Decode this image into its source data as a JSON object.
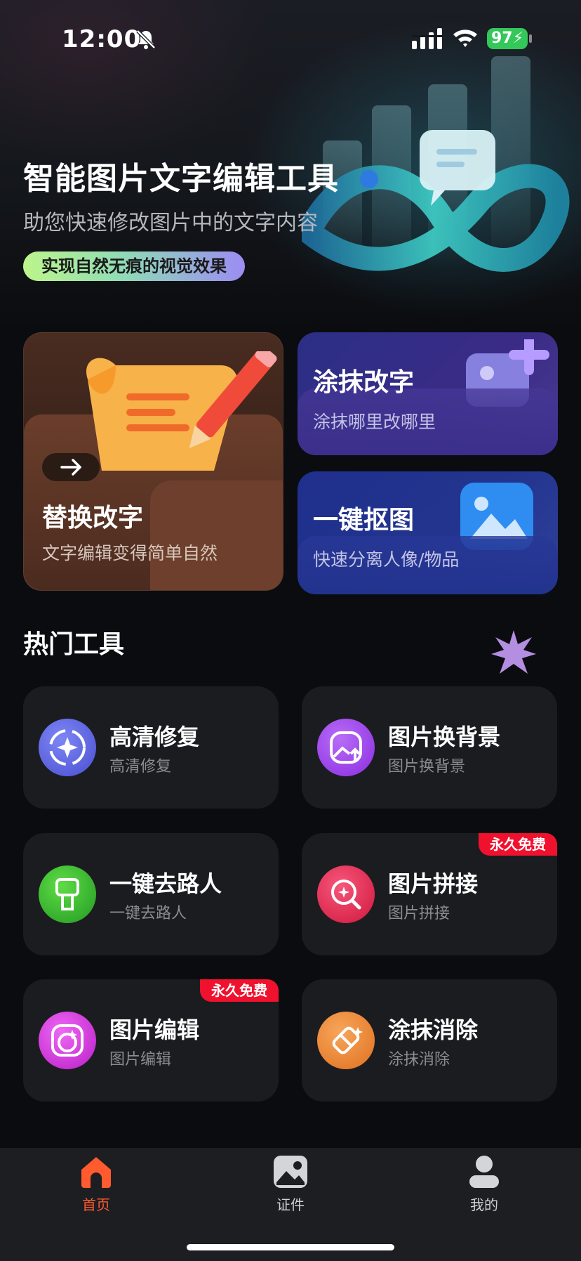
{
  "status_bar": {
    "time": "12:00",
    "battery": "97"
  },
  "hero": {
    "title": "智能图片文字编辑工具",
    "subtitle": "助您快速修改图片中的文字内容",
    "tag": "实现自然无痕的视觉效果"
  },
  "feature_cards": [
    {
      "title": "替换改字",
      "subtitle": "文字编辑变得简单自然"
    },
    {
      "title": "涂抹改字",
      "subtitle": "涂抹哪里改哪里"
    },
    {
      "title": "一键抠图",
      "subtitle": "快速分离人像/物品"
    }
  ],
  "section": {
    "title": "热门工具"
  },
  "tools": [
    {
      "title": "高清修复",
      "subtitle": "高清修复",
      "icon": "sparkle-restore-icon",
      "color": "#5a5fe0"
    },
    {
      "title": "图片换背景",
      "subtitle": "图片换背景",
      "icon": "background-swap-icon",
      "color": "#9b3ff0"
    },
    {
      "title": "一键去路人",
      "subtitle": "一键去路人",
      "icon": "brush-icon",
      "color": "#2fb82f"
    },
    {
      "title": "图片拼接",
      "subtitle": "图片拼接",
      "icon": "magnify-icon",
      "color": "#f0264e",
      "badge": "永久免费"
    },
    {
      "title": "图片编辑",
      "subtitle": "图片编辑",
      "icon": "image-edit-icon",
      "color": "#d72fe0",
      "badge": "永久免费"
    },
    {
      "title": "涂抹消除",
      "subtitle": "涂抹消除",
      "icon": "eraser-icon",
      "color": "#f08a3a"
    }
  ],
  "tabbar": [
    {
      "label": "首页",
      "icon": "home-icon",
      "active": true
    },
    {
      "label": "证件",
      "icon": "id-photo-icon",
      "active": false
    },
    {
      "label": "我的",
      "icon": "profile-icon",
      "active": false
    }
  ],
  "colors": {
    "accent": "#ff5b2e",
    "badge": "#f0112e",
    "battery": "#34c759"
  }
}
